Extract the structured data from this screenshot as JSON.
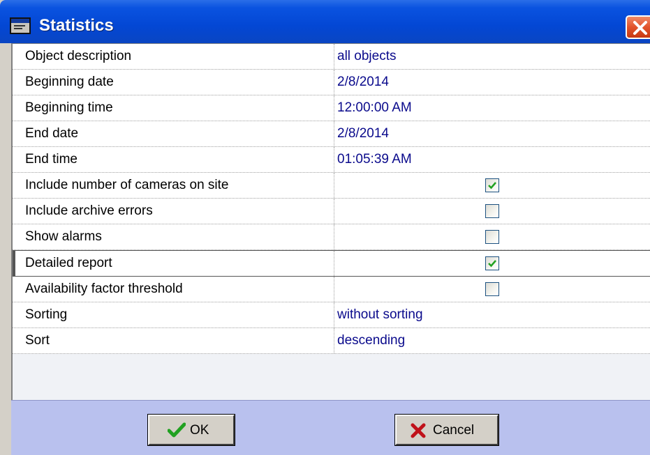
{
  "window": {
    "title": "Statistics"
  },
  "rows": [
    {
      "label": "Object description",
      "value": "all objects"
    },
    {
      "label": "Beginning date",
      "value": "2/8/2014"
    },
    {
      "label": "Beginning time",
      "value": "12:00:00 AM"
    },
    {
      "label": "End date",
      "value": "2/8/2014"
    },
    {
      "label": "End time",
      "value": "01:05:39 AM"
    },
    {
      "label": "Include number of cameras on site",
      "checked": true
    },
    {
      "label": "Include archive errors",
      "checked": false
    },
    {
      "label": "Show alarms",
      "checked": false
    },
    {
      "label": "Detailed report",
      "checked": true,
      "selected": true
    },
    {
      "label": "Availability factor threshold",
      "checked": false
    },
    {
      "label": "Sorting",
      "value": "without sorting"
    },
    {
      "label": "Sort",
      "value": "descending"
    }
  ],
  "buttons": {
    "ok_label": "OK",
    "cancel_label": "Cancel"
  },
  "colors": {
    "title_bar": "#0347d4",
    "value_text": "#0a0a8c",
    "button_bar": "#b9c1ee",
    "check": "#21a121",
    "cancel_x": "#c0121a"
  },
  "icons": {
    "title": "window-icon",
    "close": "close-icon",
    "ok": "checkmark-icon",
    "cancel": "x-mark-icon"
  }
}
